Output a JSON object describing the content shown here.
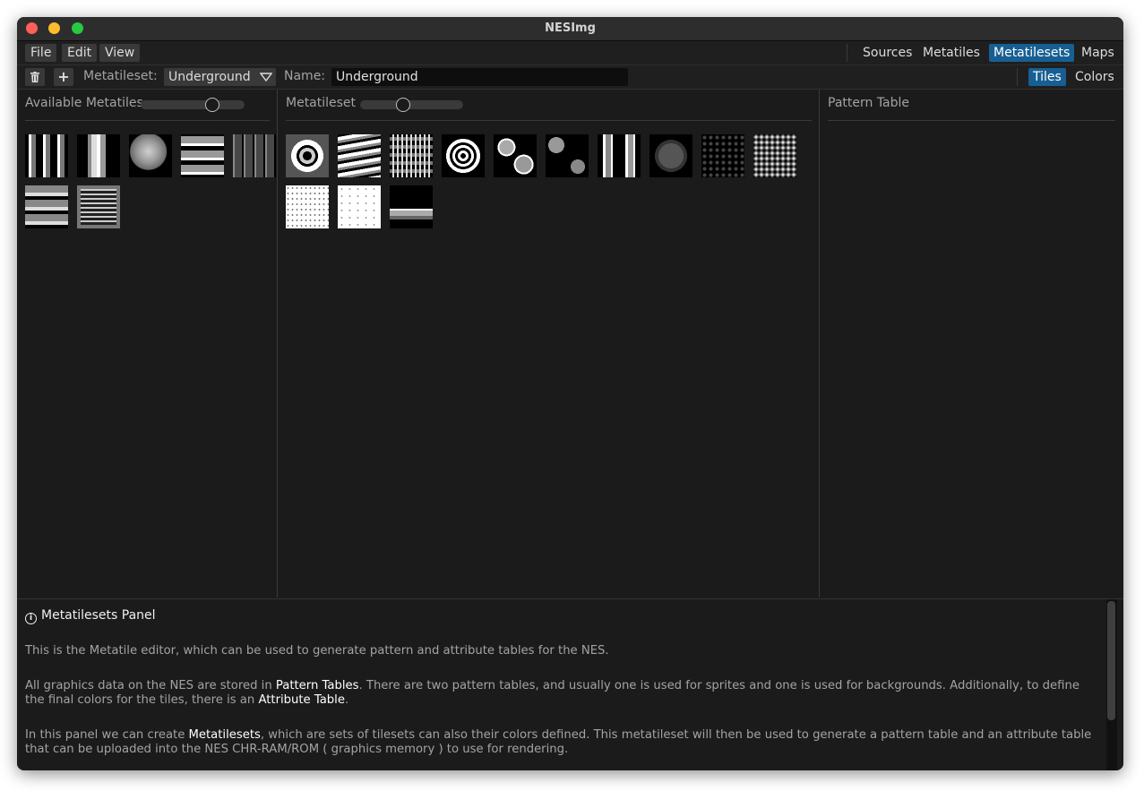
{
  "window": {
    "title": "NESImg"
  },
  "menu": {
    "file": "File",
    "edit": "Edit",
    "view": "View"
  },
  "nav": {
    "sources": "Sources",
    "metatiles": "Metatiles",
    "metatilesets": "Metatilesets",
    "maps": "Maps"
  },
  "toolbar": {
    "delete_icon": "trash-icon",
    "add_icon": "+",
    "metatileset_label": "Metatileset:",
    "metatileset_value": "Underground",
    "name_label": "Name:",
    "name_value": "Underground",
    "tiles_tab": "Tiles",
    "colors_tab": "Colors"
  },
  "available_panel": {
    "title": "Available Metatiles",
    "zoom": 0.7,
    "tile_count": 7
  },
  "metatileset_panel": {
    "title": "Metatileset",
    "zoom": 0.4,
    "tile_count": 13
  },
  "pattern_panel": {
    "title": "Pattern Table"
  },
  "help": {
    "title": "Metatilesets Panel",
    "p1": "This is the Metatile editor, which can be used to generate pattern and attribute tables for the NES.",
    "p2_a": "All graphics data on the NES are stored in ",
    "p2_b": "Pattern Tables",
    "p2_c": ". There are two pattern tables, and usually one is used for sprites and one is used for backgrounds. Additionally, to define the final colors for the tiles, there is an ",
    "p2_d": "Attribute Table",
    "p2_e": ".",
    "p3_a": "In this panel we can create ",
    "p3_b": "Metatilesets",
    "p3_c": ", which are sets of tilesets can also their colors defined. This metatileset will then be used to generate a pattern table and an attribute table that can be uploaded into the NES CHR-RAM/ROM ( graphics memory ) to use for rendering."
  },
  "colors": {
    "accent": "#175f93",
    "background": "#1b1b1b"
  }
}
